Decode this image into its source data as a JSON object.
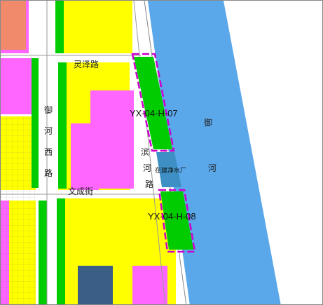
{
  "roads": {
    "lingze": "灵泽路",
    "yuhexi": "御河西路",
    "binhe": "滨河路",
    "wencheng": "文成街"
  },
  "river": "御河",
  "parcels": {
    "north": "YX-04-H-07",
    "south": "YX-04-H-08"
  },
  "facility": "在建净水厂",
  "colors": {
    "residential": "#ffff00",
    "commercial": "#ff66ff",
    "green": "#00cc00",
    "water": "#5aa7ea",
    "utility": "#3d8fc4",
    "education": "#f08a6a",
    "parcel_boundary": "#cc00cc"
  }
}
